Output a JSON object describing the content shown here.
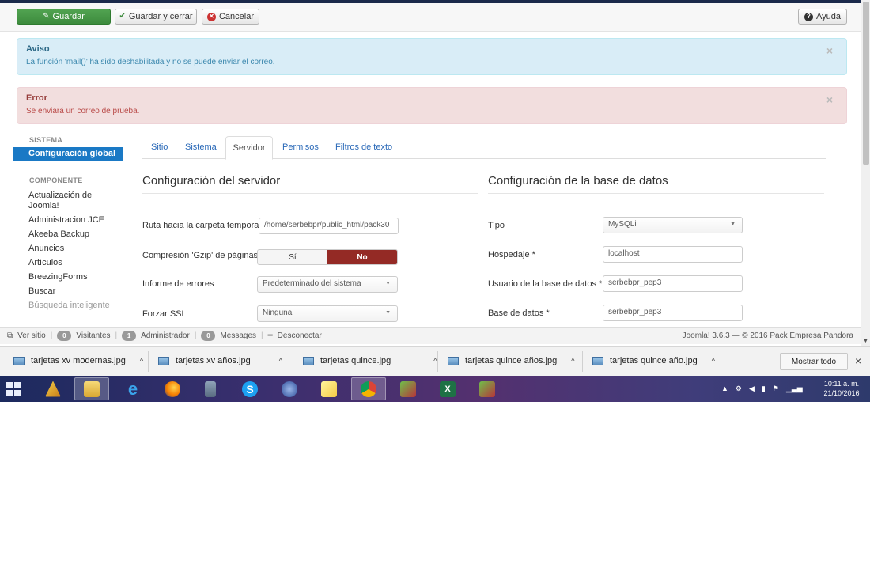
{
  "toolbar": {
    "save": "Guardar",
    "save_close": "Guardar y cerrar",
    "cancel": "Cancelar",
    "help": "Ayuda"
  },
  "alerts": [
    {
      "title": "Aviso",
      "message": "La función 'mail()' ha sido deshabilitada y no se puede enviar el correo.",
      "close": "×"
    },
    {
      "title": "Error",
      "message": "Se enviará un correo de prueba.",
      "close": "×"
    }
  ],
  "sidebar": {
    "system_heading": "SISTEMA",
    "active": "Configuración global",
    "component_heading": "COMPONENTE",
    "items": [
      "Actualización de Joomla!",
      "Administracion JCE",
      "Akeeba Backup",
      "Anuncios",
      "Artículos",
      "BreezingForms",
      "Buscar",
      "Búsqueda inteligente"
    ]
  },
  "tabs": [
    "Sitio",
    "Sistema",
    "Servidor",
    "Permisos",
    "Filtros de texto"
  ],
  "server": {
    "title": "Configuración del servidor",
    "temp_label": "Ruta hacia la carpeta temporal",
    "temp_value": "/home/serbebpr/public_html/pack30",
    "gzip_label": "Compresión 'Gzip' de páginas",
    "gzip_yes": "Sí",
    "gzip_no": "No",
    "errors_label": "Informe de errores",
    "errors_value": "Predeterminado del sistema",
    "ssl_label": "Forzar SSL",
    "ssl_value": "Ninguna"
  },
  "database": {
    "title": "Configuración de la base de datos",
    "type_label": "Tipo",
    "type_value": "MySQLi",
    "host_label": "Hospedaje *",
    "host_value": "localhost",
    "user_label": "Usuario de la base de datos *",
    "user_value": "serbebpr_pep3",
    "db_label": "Base de datos *",
    "db_value": "serbebpr_pep3"
  },
  "status": {
    "view_site": "Ver sitio",
    "visitors_count": "0",
    "visitors": "Visitantes",
    "admin_count": "1",
    "admin": "Administrador",
    "messages_count": "0",
    "messages": "Messages",
    "logout": "Desconectar",
    "right": "Joomla! 3.6.3 — © 2016 Pack Empresa Pandora"
  },
  "downloads": {
    "files": [
      "tarjetas xv modernas.jpg",
      "tarjetas xv años.jpg",
      "tarjetas quince.jpg",
      "tarjetas quince años.jpg",
      "tarjetas quince año.jpg"
    ],
    "show_all": "Mostrar todo",
    "close": "×"
  },
  "taskbar": {
    "apps": [
      "winamp-icon",
      "file-explorer-icon",
      "internet-explorer-icon",
      "firefox-icon",
      "calculator-icon",
      "skype-icon",
      "app-icon",
      "sticky-notes-icon",
      "chrome-icon",
      "image-viewer-icon",
      "excel-icon",
      "image-viewer-icon"
    ],
    "time": "10:11 a. m.",
    "date": "21/10/2016"
  }
}
